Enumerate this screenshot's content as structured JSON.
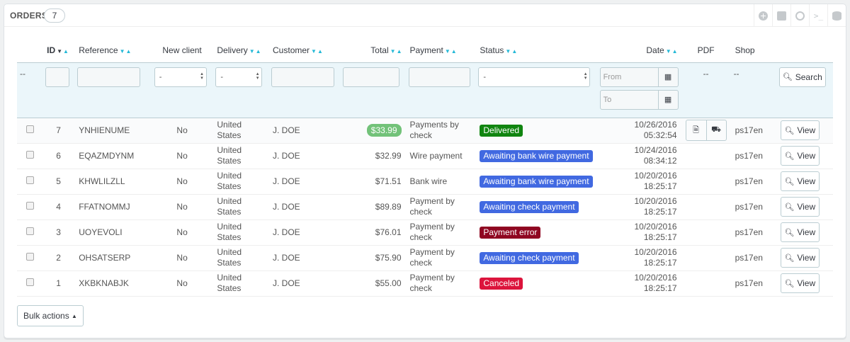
{
  "panel": {
    "title": "Orders",
    "count": "7"
  },
  "toolbar": {
    "icons": [
      "add-icon",
      "export-icon",
      "refresh-icon",
      "sql-icon",
      "database-icon"
    ],
    "sql_label": ">_"
  },
  "columns": {
    "id": "ID",
    "reference": "Reference",
    "new_client": "New client",
    "delivery": "Delivery",
    "customer": "Customer",
    "total": "Total",
    "payment": "Payment",
    "status": "Status",
    "date": "Date",
    "pdf": "PDF",
    "shop": "Shop"
  },
  "filters": {
    "placeholder_dash": "--",
    "new_client_value": "-",
    "delivery_value": "-",
    "status_value": "-",
    "date_from_placeholder": "From",
    "date_to_placeholder": "To",
    "pdf_value": "--",
    "shop_value": "--",
    "search_label": "Search"
  },
  "status_colors": {
    "Delivered": "#108510",
    "Awaiting bank wire payment": "#4169e1",
    "Awaiting check payment": "#4169e1",
    "Payment error": "#8f0621",
    "Canceled": "#dc143c"
  },
  "rows": [
    {
      "id": "7",
      "reference": "YNHIENUME",
      "new_client": "No",
      "delivery": "United States",
      "customer": "J. DOE",
      "total": "$33.99",
      "payment": "Payments by check",
      "status": "Delivered",
      "date": "10/26/2016",
      "time": "05:32:54",
      "shop": "ps17en",
      "view": "View",
      "has_pdf": true
    },
    {
      "id": "6",
      "reference": "EQAZMDYNM",
      "new_client": "No",
      "delivery": "United States",
      "customer": "J. DOE",
      "total": "$32.99",
      "payment": "Wire payment",
      "status": "Awaiting bank wire payment",
      "date": "10/24/2016",
      "time": "08:34:12",
      "shop": "ps17en",
      "view": "View",
      "has_pdf": false
    },
    {
      "id": "5",
      "reference": "KHWLILZLL",
      "new_client": "No",
      "delivery": "United States",
      "customer": "J. DOE",
      "total": "$71.51",
      "payment": "Bank wire",
      "status": "Awaiting bank wire payment",
      "date": "10/20/2016",
      "time": "18:25:17",
      "shop": "ps17en",
      "view": "View",
      "has_pdf": false
    },
    {
      "id": "4",
      "reference": "FFATNOMMJ",
      "new_client": "No",
      "delivery": "United States",
      "customer": "J. DOE",
      "total": "$89.89",
      "payment": "Payment by check",
      "status": "Awaiting check payment",
      "date": "10/20/2016",
      "time": "18:25:17",
      "shop": "ps17en",
      "view": "View",
      "has_pdf": false
    },
    {
      "id": "3",
      "reference": "UOYEVOLI",
      "new_client": "No",
      "delivery": "United States",
      "customer": "J. DOE",
      "total": "$76.01",
      "payment": "Payment by check",
      "status": "Payment error",
      "date": "10/20/2016",
      "time": "18:25:17",
      "shop": "ps17en",
      "view": "View",
      "has_pdf": false
    },
    {
      "id": "2",
      "reference": "OHSATSERP",
      "new_client": "No",
      "delivery": "United States",
      "customer": "J. DOE",
      "total": "$75.90",
      "payment": "Payment by check",
      "status": "Awaiting check payment",
      "date": "10/20/2016",
      "time": "18:25:17",
      "shop": "ps17en",
      "view": "View",
      "has_pdf": false
    },
    {
      "id": "1",
      "reference": "XKBKNABJK",
      "new_client": "No",
      "delivery": "United States",
      "customer": "J. DOE",
      "total": "$55.00",
      "payment": "Payment by check",
      "status": "Canceled",
      "date": "10/20/2016",
      "time": "18:25:17",
      "shop": "ps17en",
      "view": "View",
      "has_pdf": false
    }
  ],
  "bulk_actions_label": "Bulk actions"
}
